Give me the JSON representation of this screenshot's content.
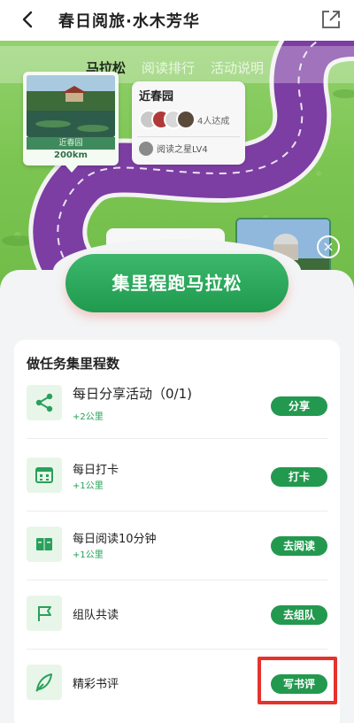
{
  "header": {
    "title": "春日阅旅·水木芳华",
    "back_icon": "chevron-left-icon",
    "share_icon": "external-share-icon"
  },
  "tabs": [
    {
      "label": "马拉松",
      "active": true
    },
    {
      "label": "阅读排行",
      "active": false
    },
    {
      "label": "活动说明",
      "active": false
    }
  ],
  "map": {
    "spot": {
      "label": "近春园",
      "distance": "200km"
    },
    "info_card": {
      "title": "近春园",
      "achieved": "4人达成",
      "badge": "阅读之星LV4"
    }
  },
  "banner": {
    "text": "集里程跑马拉松"
  },
  "tasks": {
    "title": "做任务集里程数",
    "items": [
      {
        "name": "每日分享活动（0/1)",
        "reward": "+2公里",
        "button": "分享",
        "icon": "share-icon"
      },
      {
        "name": "每日打卡",
        "reward": "+1公里",
        "button": "打卡",
        "icon": "calendar-icon"
      },
      {
        "name": "每日阅读10分钟",
        "reward": "+1公里",
        "button": "去阅读",
        "icon": "book-icon"
      },
      {
        "name": "组队共读",
        "reward": "",
        "button": "去组队",
        "icon": "flag-icon"
      },
      {
        "name": "精彩书评",
        "reward": "",
        "button": "写书评",
        "icon": "leaf-pen-icon"
      }
    ]
  },
  "colors": {
    "accent": "#23994f",
    "road": "#7c3ea3",
    "grass": "#7cc552",
    "highlight": "#e6322d"
  }
}
